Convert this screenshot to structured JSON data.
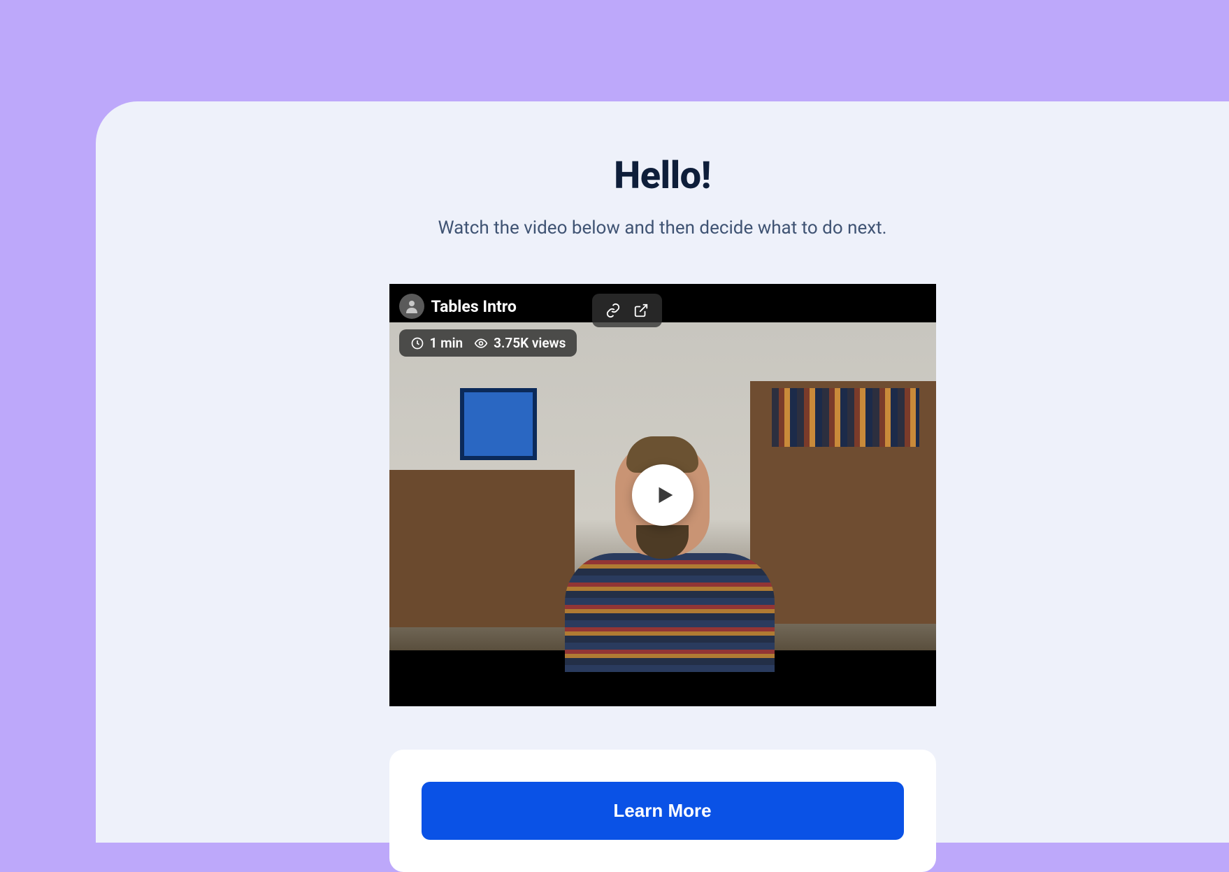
{
  "header": {
    "title": "Hello!",
    "subtitle": "Watch the video below and then decide what to do next."
  },
  "video": {
    "title": "Tables Intro",
    "duration": "1 min",
    "views": "3.75K views"
  },
  "cta": {
    "learn_more_label": "Learn More"
  }
}
